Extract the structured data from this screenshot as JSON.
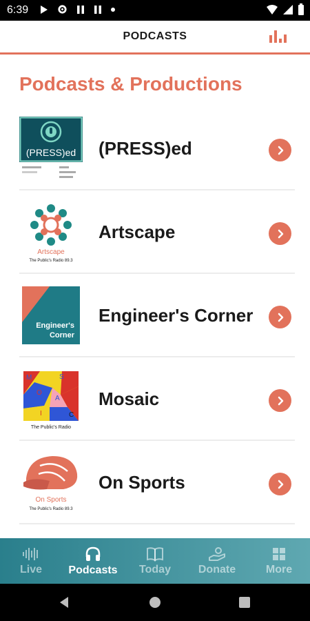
{
  "status_bar": {
    "time": "6:39"
  },
  "header": {
    "title": "PODCASTS"
  },
  "section": {
    "title": "Podcasts & Productions"
  },
  "podcasts": [
    {
      "label": "(PRESS)ed",
      "art_text": "(PRESS)ed"
    },
    {
      "label": "Artscape",
      "art_text": "Artscape",
      "art_sub": "The Public's Radio 89.3"
    },
    {
      "label": "Engineer's Corner",
      "art_text_1": "Engineer's",
      "art_text_2": "Corner"
    },
    {
      "label": "Mosaic",
      "art_sub": "The Public's Radio"
    },
    {
      "label": "On Sports",
      "art_text": "On Sports",
      "art_sub": "The Public's Radio 89.3"
    }
  ],
  "bottom_nav": {
    "items": [
      {
        "label": "Live"
      },
      {
        "label": "Podcasts"
      },
      {
        "label": "Today"
      },
      {
        "label": "Donate"
      },
      {
        "label": "More"
      }
    ]
  },
  "colors": {
    "accent": "#e2725b",
    "teal": "#2a7f8c"
  }
}
